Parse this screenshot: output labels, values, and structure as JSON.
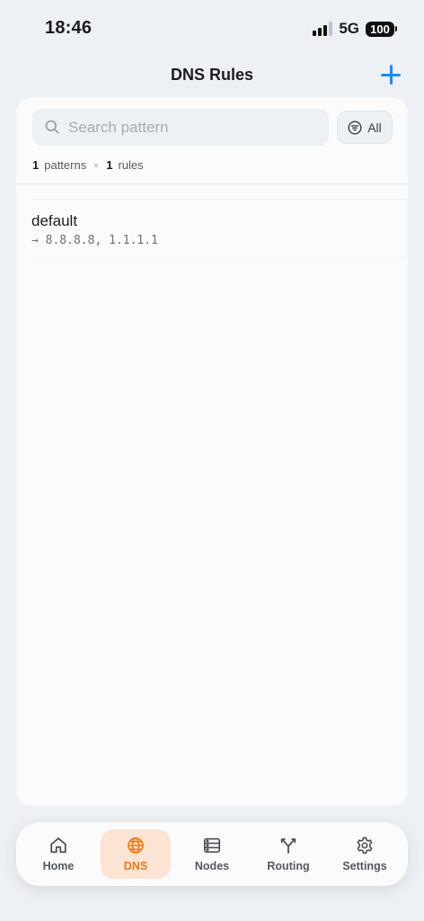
{
  "status_bar": {
    "time": "18:46",
    "network": "5G",
    "battery": "100"
  },
  "header": {
    "title": "DNS Rules",
    "add_icon": "plus-icon"
  },
  "search": {
    "placeholder": "Search pattern",
    "value": ""
  },
  "filter": {
    "label": "All",
    "icon": "filter-lines-icon"
  },
  "stats": {
    "patterns_count": "1",
    "patterns_label": "patterns",
    "rules_count": "1",
    "rules_label": "rules"
  },
  "rules": [
    {
      "name": "default",
      "target": "→ 8.8.8.8, 1.1.1.1"
    }
  ],
  "tab_bar": {
    "tabs": [
      {
        "label": "Home",
        "icon": "house-icon",
        "active": false
      },
      {
        "label": "DNS",
        "icon": "globe-icon",
        "active": true
      },
      {
        "label": "Nodes",
        "icon": "server-icon",
        "active": false
      },
      {
        "label": "Routing",
        "icon": "fork-icon",
        "active": false
      },
      {
        "label": "Settings",
        "icon": "gear-icon",
        "active": false
      }
    ]
  },
  "colors": {
    "accent_blue": "#1a8cff",
    "active_tab": "#f07a18",
    "active_tab_bg": "#fbe4d3",
    "background": "#edf0f4"
  }
}
